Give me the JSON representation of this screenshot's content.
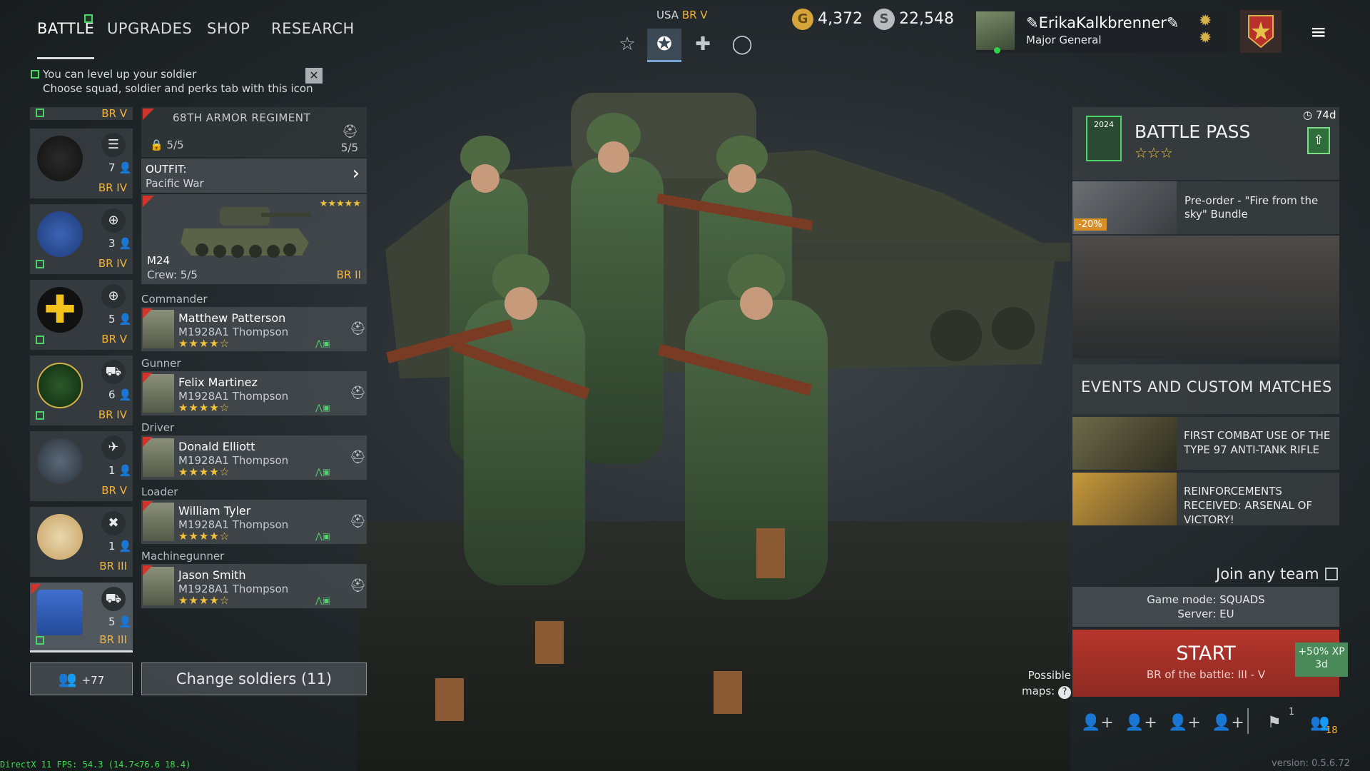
{
  "nav": {
    "tabs": [
      "BATTLE",
      "UPGRADES",
      "SHOP",
      "RESEARCH"
    ],
    "active": "BATTLE"
  },
  "hint": {
    "line1": "You can level up your soldier",
    "line2": "Choose squad, soldier and perks tab with this icon",
    "close": "✕"
  },
  "battle_rating": {
    "nation": "USA",
    "br": "BR V"
  },
  "army_tabs": [
    "star-outline-icon",
    "star-badge-icon",
    "cross-icon",
    "circle-icon"
  ],
  "currency": {
    "gold": "4,372",
    "silver": "22,548",
    "gold_symbol": "G",
    "silver_symbol": "S"
  },
  "profile": {
    "name": "ErikaKalkbrenner",
    "rank": "Major General"
  },
  "squads": [
    {
      "br": "BR V",
      "count": ""
    },
    {
      "br": "BR IV",
      "count": "7"
    },
    {
      "br": "BR IV",
      "count": "3"
    },
    {
      "br": "BR V",
      "count": "5"
    },
    {
      "br": "BR IV",
      "count": "6"
    },
    {
      "br": "BR V",
      "count": "1"
    },
    {
      "br": "BR III",
      "count": "1"
    },
    {
      "br": "BR III",
      "count": "5"
    }
  ],
  "squad_detail": {
    "name": "68TH ARMOR REGIMENT",
    "slots": "5/5",
    "vehicle_slots": "5/5",
    "outfit_label": "OUTFIT:",
    "outfit_value": "Pacific War",
    "vehicle_name": "M24",
    "crew": "Crew: 5/5",
    "vehicle_br": "BR II",
    "vehicle_stars": "★★★★★"
  },
  "soldiers": [
    {
      "role": "Commander",
      "name": "Matthew Patterson",
      "weapon": "M1928A1 Thompson",
      "stars": "★★★★☆"
    },
    {
      "role": "Gunner",
      "name": "Felix Martinez",
      "weapon": "M1928A1 Thompson",
      "stars": "★★★★☆"
    },
    {
      "role": "Driver",
      "name": "Donald Elliott",
      "weapon": "M1928A1 Thompson",
      "stars": "★★★★☆"
    },
    {
      "role": "Loader",
      "name": "William Tyler",
      "weapon": "M1928A1 Thompson",
      "stars": "★★★★☆"
    },
    {
      "role": "Machinegunner",
      "name": "Jason Smith",
      "weapon": "M1928A1 Thompson",
      "stars": "★★★★☆"
    }
  ],
  "bottom": {
    "reserve": "+77",
    "change": "Change soldiers (11)"
  },
  "battle_pass": {
    "title": "BATTLE PASS",
    "time": "74d",
    "stars": "☆☆☆",
    "year": "2024"
  },
  "promo": {
    "text": "Pre-order - \"Fire from the sky\" Bundle",
    "discount": "-20%"
  },
  "events": {
    "title": "EVENTS AND CUSTOM MATCHES",
    "items": [
      "FIRST COMBAT USE OF THE TYPE 97 ANTI-TANK RIFLE",
      "REINFORCEMENTS RECEIVED: ARSENAL OF VICTORY!"
    ]
  },
  "join": "Join any team",
  "mode": {
    "game": "Game mode: SQUADS",
    "server": "Server: EU"
  },
  "start": {
    "label": "START",
    "sub": "BR of the battle: III - V",
    "xp": "+50% XP",
    "xp_time": "3d"
  },
  "possible_maps": {
    "line1": "Possible",
    "line2": "maps:",
    "q": "?"
  },
  "bottom_icons": {
    "flag_count": "1",
    "friends_count": "18"
  },
  "debug": {
    "fps": "DirectX 11 FPS: 54.3 (14.7<76.6 18.4)",
    "version": "version: 0.5.6.72"
  },
  "colors": {
    "accent_green": "#4cd36a",
    "br_gold": "#f2b43a",
    "start_red": "#b6362c",
    "star_yellow": "#f2c23a"
  }
}
